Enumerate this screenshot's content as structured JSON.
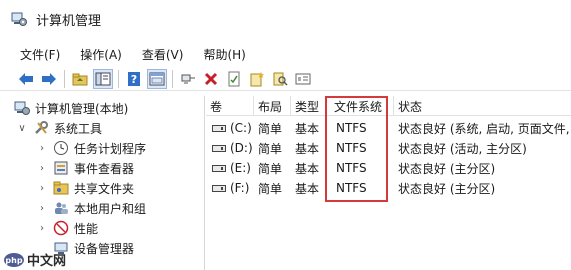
{
  "window": {
    "title": "计算机管理"
  },
  "menubar": [
    "文件(F)",
    "操作(A)",
    "查看(V)",
    "帮助(H)"
  ],
  "toolbar": {
    "buttons": [
      "back-icon",
      "forward-icon",
      "up-folder-icon",
      "show-hide-tree-icon",
      "help-icon",
      "console-icon",
      "connect-icon",
      "delete-icon",
      "properties-icon",
      "new-folder-icon",
      "search-icon",
      "list-view-icon"
    ]
  },
  "tree": {
    "root": "计算机管理(本地)",
    "system_tools": "系统工具",
    "items": [
      "任务计划程序",
      "事件查看器",
      "共享文件夹",
      "本地用户和组",
      "性能",
      "设备管理器"
    ]
  },
  "list": {
    "columns": [
      "卷",
      "布局",
      "类型",
      "文件系统",
      "状态"
    ],
    "rows": [
      {
        "volume": "(C:)",
        "layout": "简单",
        "type": "基本",
        "fs": "NTFS",
        "status": "状态良好 (系统, 启动, 页面文件, 活"
      },
      {
        "volume": "(D:)",
        "layout": "简单",
        "type": "基本",
        "fs": "NTFS",
        "status": "状态良好 (活动, 主分区)"
      },
      {
        "volume": "(E:)",
        "layout": "简单",
        "type": "基本",
        "fs": "NTFS",
        "status": "状态良好 (主分区)"
      },
      {
        "volume": "(F:)",
        "layout": "简单",
        "type": "基本",
        "fs": "NTFS",
        "status": "状态良好 (主分区)"
      }
    ]
  },
  "watermark": {
    "text": "中文网",
    "sub": "php"
  },
  "colors": {
    "highlight": "#d43a3a",
    "accent": "#1f6fd1"
  }
}
